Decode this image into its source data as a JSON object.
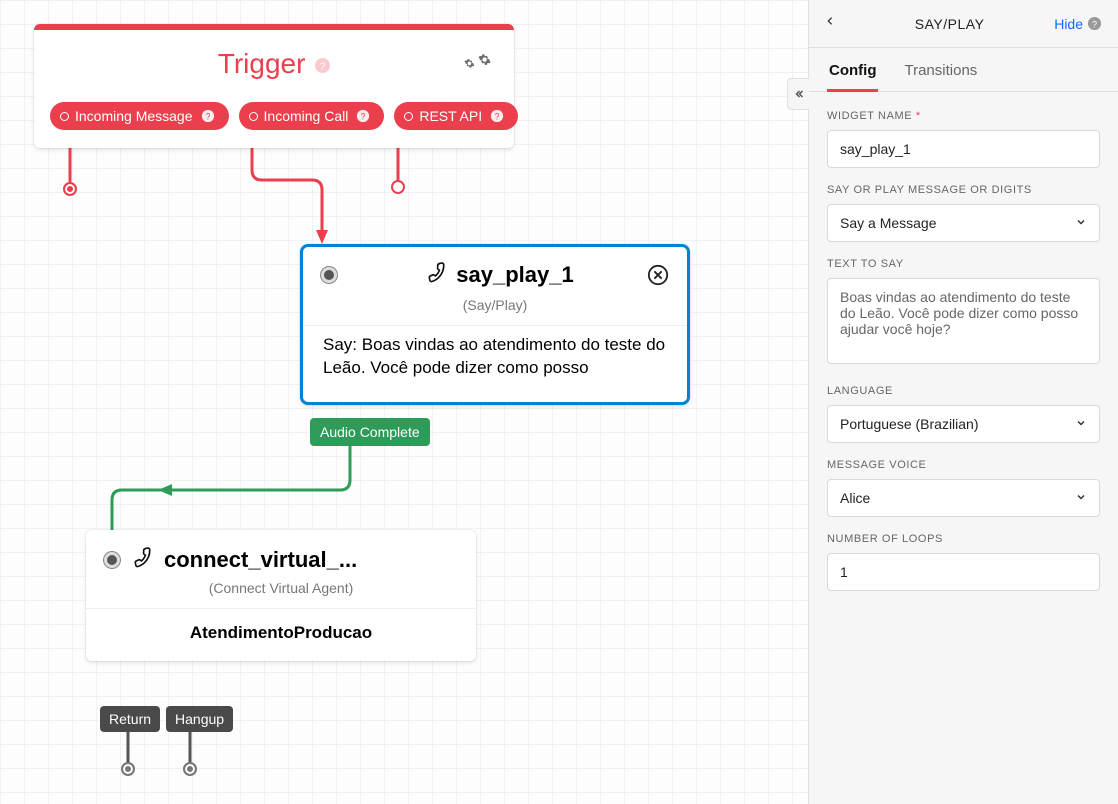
{
  "canvas": {
    "trigger": {
      "title": "Trigger",
      "outlets": [
        {
          "label": "Incoming Message"
        },
        {
          "label": "Incoming Call"
        },
        {
          "label": "REST API"
        }
      ]
    },
    "sayplay": {
      "title": "say_play_1",
      "subtitle": "(Say/Play)",
      "body": "Say: Boas vindas ao atendimento do teste do Leão. Você pode dizer como posso",
      "transition_label": "Audio Complete"
    },
    "connect": {
      "title": "connect_virtual_...",
      "subtitle": "(Connect Virtual Agent)",
      "body": "AtendimentoProducao",
      "outlets": [
        {
          "label": "Return"
        },
        {
          "label": "Hangup"
        }
      ]
    }
  },
  "sidebar": {
    "title": "SAY/PLAY",
    "hide_label": "Hide",
    "tabs": {
      "config": "Config",
      "transitions": "Transitions"
    },
    "form": {
      "widget_name_label": "WIDGET NAME",
      "widget_name_value": "say_play_1",
      "msg_type_label": "SAY OR PLAY MESSAGE OR DIGITS",
      "msg_type_value": "Say a Message",
      "text_label": "TEXT TO SAY",
      "text_value": "Boas vindas ao atendimento do teste do Leão. Você pode dizer como posso ajudar você hoje?",
      "language_label": "LANGUAGE",
      "language_value": "Portuguese (Brazilian)",
      "voice_label": "MESSAGE VOICE",
      "voice_value": "Alice",
      "loops_label": "NUMBER OF LOOPS",
      "loops_value": "1"
    }
  }
}
